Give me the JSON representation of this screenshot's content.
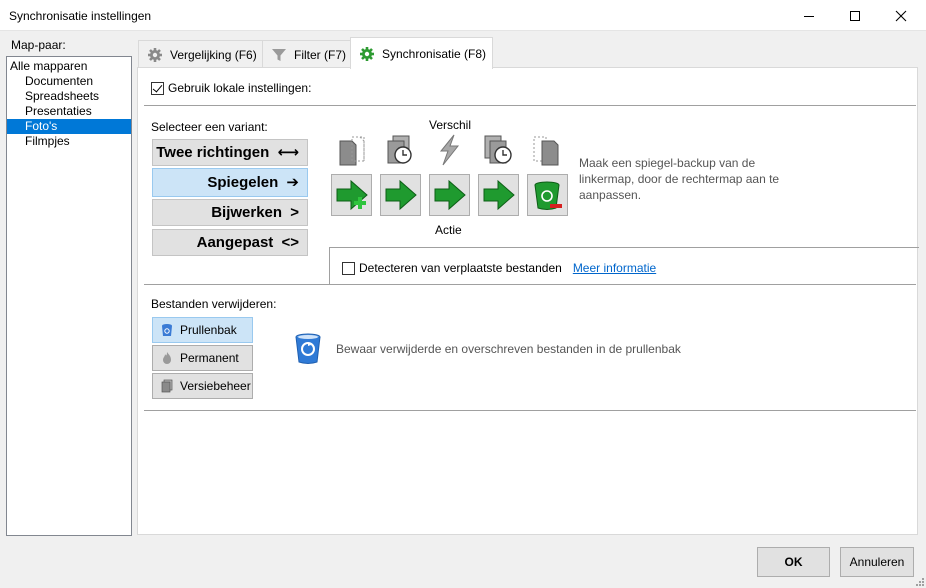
{
  "window": {
    "title": "Synchronisatie instellingen"
  },
  "folders": {
    "label": "Map-paar:",
    "items": [
      {
        "label": "Alle mapparen"
      },
      {
        "label": "Documenten"
      },
      {
        "label": "Spreadsheets"
      },
      {
        "label": "Presentaties"
      },
      {
        "label": "Foto's"
      },
      {
        "label": "Filmpjes"
      }
    ],
    "selected": "Foto's"
  },
  "tabs": [
    {
      "label": "Vergelijking (F6)",
      "icon": "gear-icon"
    },
    {
      "label": "Filter (F7)",
      "icon": "funnel-icon"
    },
    {
      "label": "Synchronisatie (F8)",
      "icon": "gear-green-icon",
      "active": true
    }
  ],
  "sync": {
    "use_local_label": "Gebruik lokale instellingen:",
    "use_local_checked": true,
    "variant_label": "Selecteer een variant:",
    "variants": [
      {
        "label": "Twee richtingen",
        "glyph": "⟷"
      },
      {
        "label": "Spiegelen",
        "glyph": "➔",
        "active": true
      },
      {
        "label": "Bijwerken",
        "glyph": ">"
      },
      {
        "label": "Aangepast",
        "glyph": "<>"
      }
    ],
    "verschil_label": "Verschil",
    "actie_label": "Actie",
    "description": "Maak een spiegel-backup van de linkermap, door de rechtermap aan te aanpassen.",
    "detect_label": "Detecteren van verplaatste bestanden",
    "detect_checked": false,
    "more_info": "Meer informatie"
  },
  "deletion": {
    "label": "Bestanden verwijderen:",
    "options": [
      {
        "label": "Prullenbak",
        "icon": "recycle-bin-icon",
        "active": true
      },
      {
        "label": "Permanent",
        "icon": "flame-icon"
      },
      {
        "label": "Versiebeheer",
        "icon": "versioning-icon"
      }
    ],
    "description": "Bewaar verwijderde en overschreven bestanden in de prullenbak"
  },
  "footer": {
    "ok": "OK",
    "cancel": "Annuleren"
  },
  "colors": {
    "selection": "#0078d7",
    "active_button": "#cce4f7",
    "green_arrow": "#1f9a2f",
    "link": "#0066cc"
  }
}
